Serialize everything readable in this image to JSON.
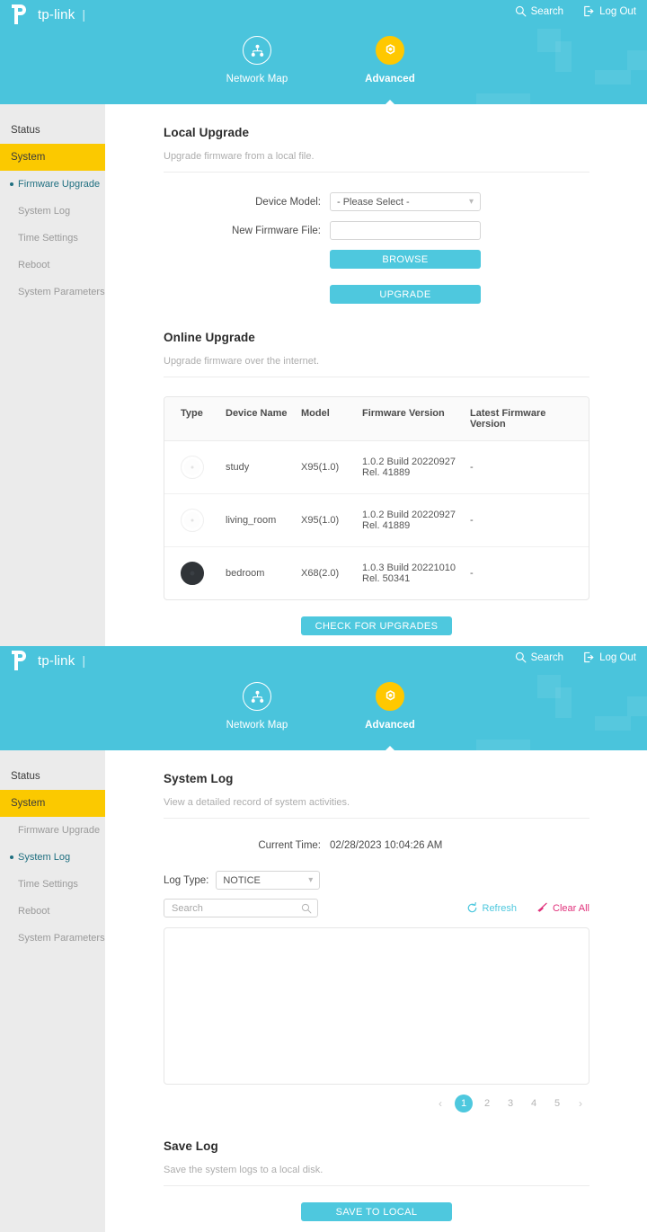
{
  "brand": {
    "name": "tp-link",
    "divider": "|"
  },
  "header": {
    "search_label": "Search",
    "logout_label": "Log Out",
    "tabs": [
      {
        "label": "Network Map",
        "icon": "network-map-icon",
        "active": false
      },
      {
        "label": "Advanced",
        "icon": "gear-icon",
        "active": true
      }
    ]
  },
  "colors": {
    "header_teal": "#4ac4dc",
    "button_teal": "#4ec8de",
    "accent_yellow": "#fbc900",
    "nav_yellow": "#ffc800",
    "link_teal": "#4ec8de",
    "clear_pink": "#e0317b",
    "sidebar_bg": "#ebebeb",
    "current_item": "#1f6f80"
  },
  "screen1": {
    "sidebar": {
      "top_items": [
        {
          "label": "Status",
          "active": false
        },
        {
          "label": "System",
          "active": true
        }
      ],
      "sub_items": [
        {
          "label": "Firmware Upgrade",
          "current": true
        },
        {
          "label": "System Log",
          "current": false
        },
        {
          "label": "Time Settings",
          "current": false
        },
        {
          "label": "Reboot",
          "current": false
        },
        {
          "label": "System Parameters",
          "current": false
        }
      ]
    },
    "local_upgrade": {
      "title": "Local Upgrade",
      "description": "Upgrade firmware from a local file.",
      "device_model_label": "Device Model:",
      "device_model_value": "- Please Select -",
      "firmware_file_label": "New Firmware File:",
      "firmware_file_value": "",
      "browse_label": "BROWSE",
      "upgrade_label": "UPGRADE"
    },
    "online_upgrade": {
      "title": "Online Upgrade",
      "description": "Upgrade firmware over the internet.",
      "columns": [
        "Type",
        "Device Name",
        "Model",
        "Firmware Version",
        "Latest Firmware Version"
      ],
      "rows": [
        {
          "type_icon": "device-light",
          "device_name": "study",
          "model": "X95(1.0)",
          "firmware_version": "1.0.2 Build 20220927 Rel. 41889",
          "latest_firmware_version": "-"
        },
        {
          "type_icon": "device-light",
          "device_name": "living_room",
          "model": "X95(1.0)",
          "firmware_version": "1.0.2 Build 20220927 Rel. 41889",
          "latest_firmware_version": "-"
        },
        {
          "type_icon": "device-dark",
          "device_name": "bedroom",
          "model": "X68(2.0)",
          "firmware_version": "1.0.3 Build 20221010 Rel. 50341",
          "latest_firmware_version": "-"
        }
      ],
      "check_label": "CHECK FOR UPGRADES"
    }
  },
  "screen2": {
    "sidebar": {
      "top_items": [
        {
          "label": "Status",
          "active": false
        },
        {
          "label": "System",
          "active": true
        }
      ],
      "sub_items": [
        {
          "label": "Firmware Upgrade",
          "current": false
        },
        {
          "label": "System Log",
          "current": true
        },
        {
          "label": "Time Settings",
          "current": false
        },
        {
          "label": "Reboot",
          "current": false
        },
        {
          "label": "System Parameters",
          "current": false
        }
      ]
    },
    "system_log": {
      "title": "System Log",
      "description": "View a detailed record of system activities.",
      "current_time_label": "Current Time:",
      "current_time_value": "02/28/2023 10:04:26 AM",
      "log_type_label": "Log Type:",
      "log_type_value": "NOTICE",
      "search_placeholder": "Search",
      "search_value": "",
      "refresh_label": "Refresh",
      "clear_all_label": "Clear All",
      "log_entries": [],
      "pagination": {
        "prev": "‹",
        "next": "›",
        "pages": [
          "1",
          "2",
          "3",
          "4",
          "5"
        ],
        "active_page": "1"
      }
    },
    "save_log": {
      "title": "Save Log",
      "description": "Save the system logs to a local disk.",
      "save_label": "SAVE TO LOCAL"
    }
  }
}
